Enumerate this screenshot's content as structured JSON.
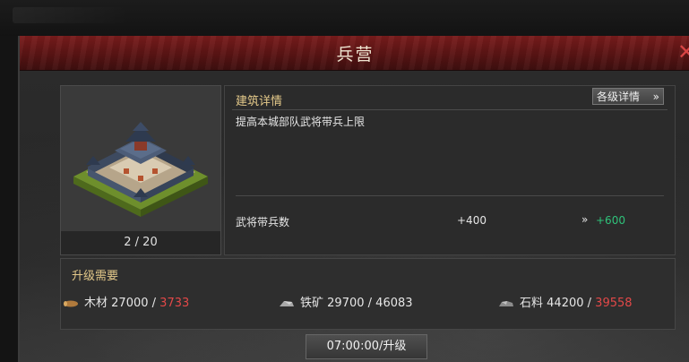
{
  "window": {
    "title": "兵营"
  },
  "building": {
    "level_text": "2 / 20"
  },
  "detail": {
    "heading": "建筑详情",
    "more_button": "各级详情",
    "more_chevron": "»",
    "description": "提高本城部队武将带兵上限",
    "stat": {
      "label": "武将带兵数",
      "current": "+400",
      "arrow": "»",
      "next": "+600"
    }
  },
  "requirements": {
    "heading": "升级需要",
    "resources": [
      {
        "name": "木材",
        "required": "27000",
        "sep": " / ",
        "owned": "3733",
        "short": true,
        "icon": "wood-icon"
      },
      {
        "name": "铁矿",
        "required": "29700",
        "sep": " / ",
        "owned": "46083",
        "short": false,
        "icon": "iron-ore-icon"
      },
      {
        "name": "石料",
        "required": "44200",
        "sep": " / ",
        "owned": "39558",
        "short": true,
        "icon": "stone-icon"
      }
    ]
  },
  "upgrade_button": "07:00:00/升级",
  "colors": {
    "title_bar": "#6a1818",
    "accent_gold": "#e4c98a",
    "positive": "#2fc27a",
    "shortage": "#e24848"
  }
}
